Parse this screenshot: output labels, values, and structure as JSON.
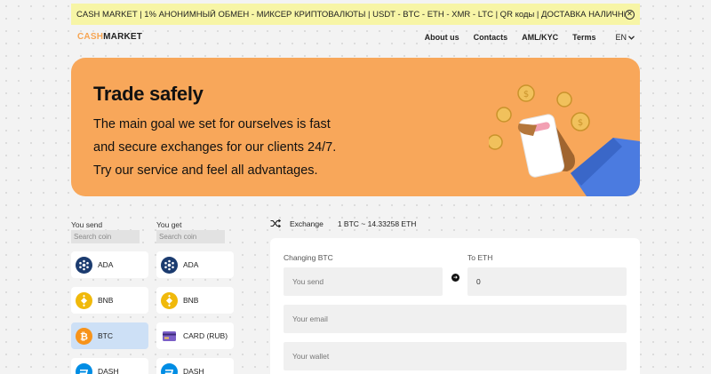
{
  "announcement": {
    "text": "CASH MARKET | 1% АНОНИМНЫЙ ОБМЕН - МИКСЕР КРИПТОВАЛЮТЫ | USDT - BTC - ETH - XMR - LTC | QR коды | ДОСТАВКА НАЛИЧНЫХ"
  },
  "header": {
    "logo_part1": "CASH",
    "logo_part2": "MARKET",
    "nav": [
      "About us",
      "Contacts",
      "AML/KYC",
      "Terms"
    ],
    "lang": "EN"
  },
  "hero": {
    "title": "Trade safely",
    "lines": [
      "The main goal we set for ourselves is fast",
      "and secure exchanges for our clients 24/7.",
      "Try our service and feel all advantages."
    ],
    "color": "#f8a75a"
  },
  "send": {
    "label": "You send",
    "search_placeholder": "Search coin",
    "coins": [
      "ADA",
      "BNB",
      "BTC",
      "DASH"
    ],
    "selected": "BTC"
  },
  "get": {
    "label": "You get",
    "search_placeholder": "Search coin",
    "coins": [
      "ADA",
      "BNB",
      "CARD (RUB)",
      "DASH"
    ]
  },
  "exchange": {
    "label": "Exchange",
    "rate": "1 BTC ~ 14.33258 ETH",
    "changing_label": "Changing BTC",
    "to_label": "To ETH",
    "send_placeholder": "You send",
    "to_value": "0",
    "email_placeholder": "Your email",
    "wallet_placeholder": "Your wallet"
  },
  "colors": {
    "accent": "#f8a75a",
    "announce_bg": "#f7f5a6",
    "selected_coin_bg": "#cde0f6",
    "ada": "#1b3b6f",
    "bnb": "#f0b90b",
    "btc": "#f7931a",
    "dash": "#008de4"
  }
}
